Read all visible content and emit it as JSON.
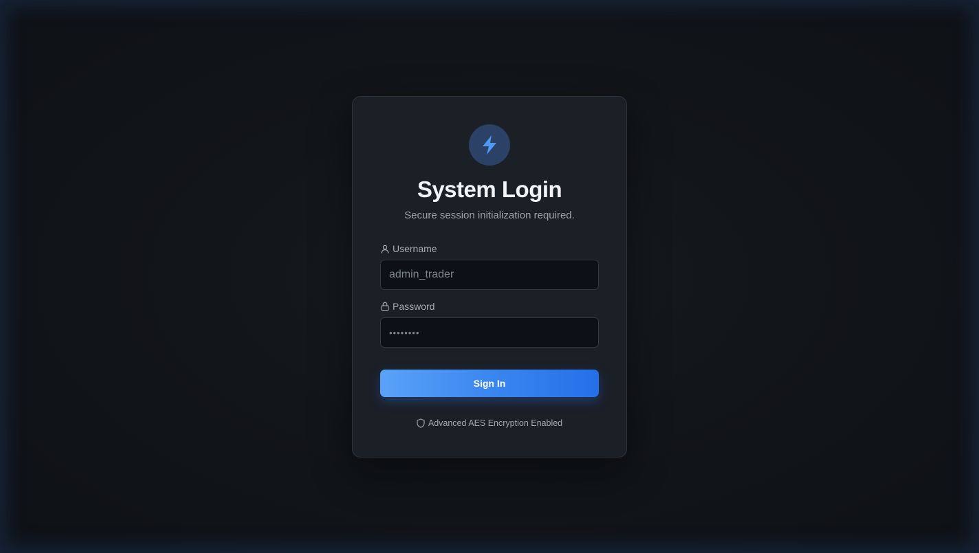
{
  "login": {
    "logo_icon": "lightning-bolt-icon",
    "title": "System Login",
    "subtitle": "Secure session initialization required.",
    "username": {
      "icon": "user-icon",
      "label": "Username",
      "value": "admin_trader"
    },
    "password": {
      "icon": "lock-icon",
      "label": "Password",
      "value": "••••••••"
    },
    "submit_label": "Sign In",
    "footer": {
      "icon": "shield-icon",
      "text": "Advanced AES Encryption Enabled"
    }
  },
  "colors": {
    "accent": "#3b87f0",
    "accent_light": "#5aa2f8",
    "card_bg": "#1b1f26",
    "page_bg": "#121519",
    "input_bg": "#0d1016"
  }
}
